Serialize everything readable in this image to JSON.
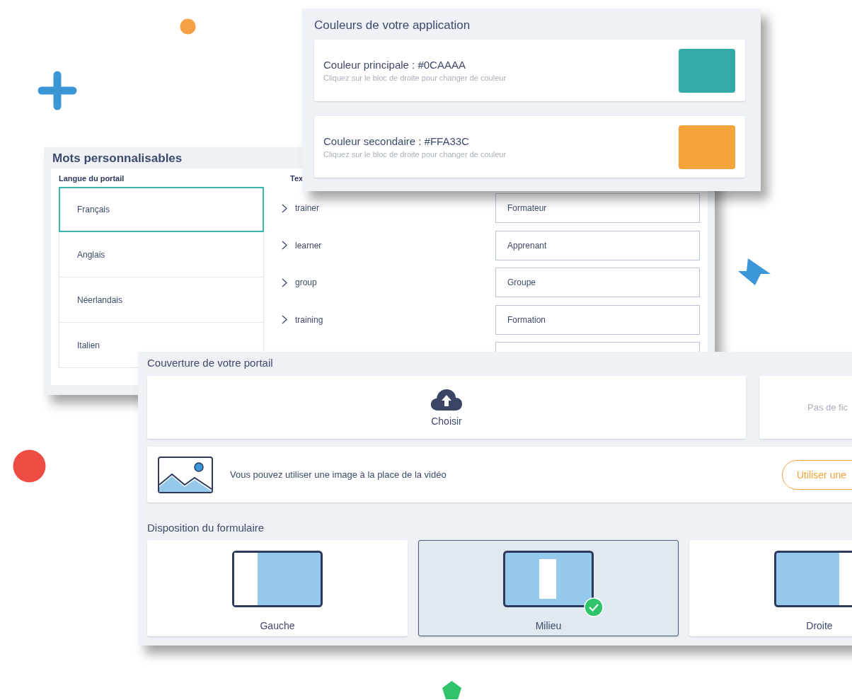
{
  "words_panel": {
    "title": "Mots personnalisables",
    "language_column": "Langue du portail",
    "text_column": "Tex",
    "languages": [
      {
        "label": "Français",
        "selected": true
      },
      {
        "label": "Anglais",
        "selected": false
      },
      {
        "label": "Néerlandais",
        "selected": false
      },
      {
        "label": "Italien",
        "selected": false
      }
    ],
    "terms": [
      {
        "key": "trainer",
        "value": "Formateur",
        "expanded": false
      },
      {
        "key": "learner",
        "value": "Apprenant",
        "expanded": false
      },
      {
        "key": "group",
        "value": "Groupe",
        "expanded": false
      },
      {
        "key": "training",
        "value": "Formation",
        "expanded": false
      }
    ]
  },
  "colors_panel": {
    "title": "Couleurs de votre application",
    "items": [
      {
        "label": "Couleur principale : #0CAAAA",
        "hint": "Cliquez sur le bloc de droite pour changer de couleur",
        "color": "#31aaa9"
      },
      {
        "label": "Couleur secondaire : #FFA33C",
        "hint": "Cliquez sur le bloc de droite pour changer de couleur",
        "color": "#f7a33c"
      }
    ]
  },
  "cover_panel": {
    "title": "Couverture de votre portail",
    "upload_button": "Choisir",
    "file_status": "Pas de fic",
    "image_notice": "Vous pouvez utiliser une image à la place de la vidéo",
    "image_button": "Utiliser une",
    "layout_title": "Disposition du formulaire",
    "layouts": [
      {
        "label": "Gauche",
        "kind": "left",
        "selected": false
      },
      {
        "label": "Milieu",
        "kind": "middle",
        "selected": true
      },
      {
        "label": "Droite",
        "kind": "right",
        "selected": false
      }
    ]
  }
}
